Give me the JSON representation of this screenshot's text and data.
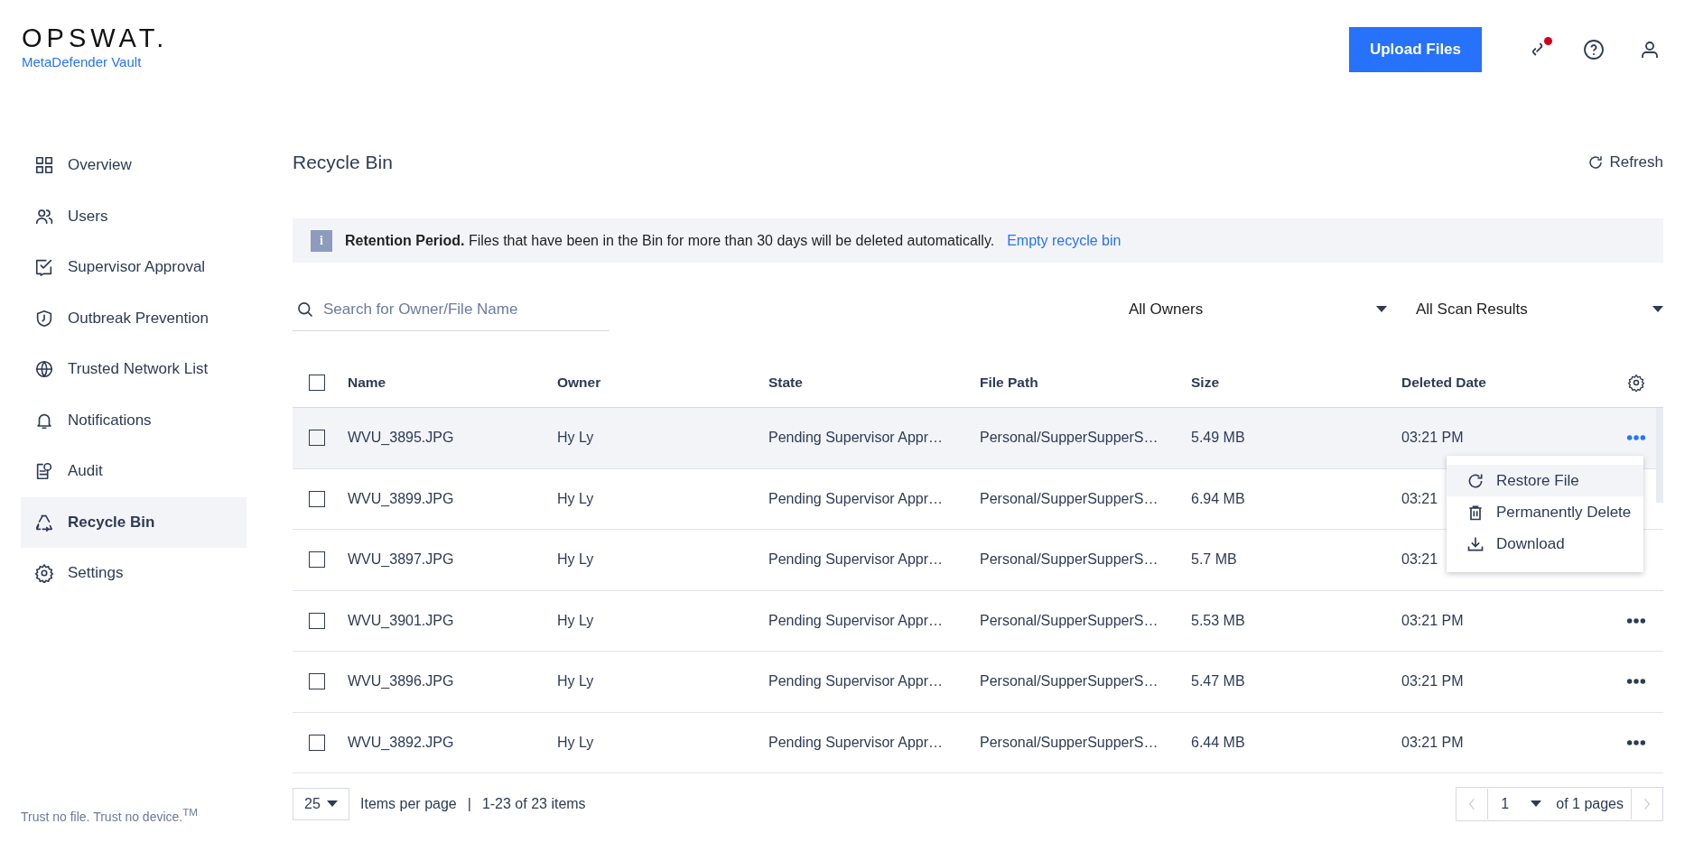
{
  "header": {
    "logo": "OPSWAT.",
    "product": "MetaDefender Vault",
    "upload_button": "Upload Files",
    "notification_dot": true
  },
  "sidebar": {
    "items": [
      {
        "label": "Overview",
        "selected": false
      },
      {
        "label": "Users",
        "selected": false
      },
      {
        "label": "Supervisor Approval",
        "selected": false
      },
      {
        "label": "Outbreak Prevention",
        "selected": false
      },
      {
        "label": "Trusted Network List",
        "selected": false
      },
      {
        "label": "Notifications",
        "selected": false
      },
      {
        "label": "Audit",
        "selected": false
      },
      {
        "label": "Recycle Bin",
        "selected": true
      },
      {
        "label": "Settings",
        "selected": false
      }
    ],
    "footer": "Trust no file. Trust no device.$^{TM}$"
  },
  "page": {
    "title": "Recycle Bin",
    "refresh": "Refresh"
  },
  "banner": {
    "icon": "i",
    "title": "Retention Period.",
    "text": "Files that have been in the Bin for more than 30 days will be deleted automatically.",
    "link": "Empty recycle bin"
  },
  "filters": {
    "search_placeholder": "Search for Owner/File Name",
    "owner": "All Owners",
    "scan_results": "All Scan Results"
  },
  "table": {
    "select_all": false,
    "columns": [
      "Name",
      "Owner",
      "State",
      "File Path",
      "Size",
      "Deleted Date"
    ],
    "rows": [
      {
        "name": "WVU_3895.JPG",
        "owner": "Hy Ly",
        "state": "Pending Supervisor Appr…",
        "file_path": "Personal/SupperSupperS…",
        "size": "5.49 MB",
        "deleted_date": "03:21 PM",
        "checked": false,
        "hovered": true,
        "actions_visible": true
      },
      {
        "name": "WVU_3899.JPG",
        "owner": "Hy Ly",
        "state": "Pending Supervisor Appr…",
        "file_path": "Personal/SupperSupperS…",
        "size": "6.94 MB",
        "deleted_date": "03:21",
        "checked": false,
        "hovered": false,
        "actions_visible": false
      },
      {
        "name": "WVU_3897.JPG",
        "owner": "Hy Ly",
        "state": "Pending Supervisor Appr…",
        "file_path": "Personal/SupperSupperS…",
        "size": "5.7 MB",
        "deleted_date": "03:21",
        "checked": false,
        "hovered": false,
        "actions_visible": false
      },
      {
        "name": "WVU_3901.JPG",
        "owner": "Hy Ly",
        "state": "Pending Supervisor Appr…",
        "file_path": "Personal/SupperSupperS…",
        "size": "5.53 MB",
        "deleted_date": "03:21 PM",
        "checked": false,
        "hovered": false,
        "actions_visible": true
      },
      {
        "name": "WVU_3896.JPG",
        "owner": "Hy Ly",
        "state": "Pending Supervisor Appr…",
        "file_path": "Personal/SupperSupperS…",
        "size": "5.47 MB",
        "deleted_date": "03:21 PM",
        "checked": false,
        "hovered": false,
        "actions_visible": true
      },
      {
        "name": "WVU_3892.JPG",
        "owner": "Hy Ly",
        "state": "Pending Supervisor Appr…",
        "file_path": "Personal/SupperSupperS…",
        "size": "6.44 MB",
        "deleted_date": "03:21 PM",
        "checked": false,
        "hovered": false,
        "actions_visible": true
      }
    ]
  },
  "context_menu": {
    "open": true,
    "items": [
      {
        "label": "Restore File",
        "highlighted": true
      },
      {
        "label": "Permanently Delete",
        "highlighted": false
      },
      {
        "label": "Download",
        "highlighted": false
      }
    ]
  },
  "pagination": {
    "page_size": "25",
    "items_per_page": "Items per page",
    "separator": "|",
    "range": "1-23 of 23 items",
    "page": "1",
    "of_pages": "of 1 pages"
  }
}
